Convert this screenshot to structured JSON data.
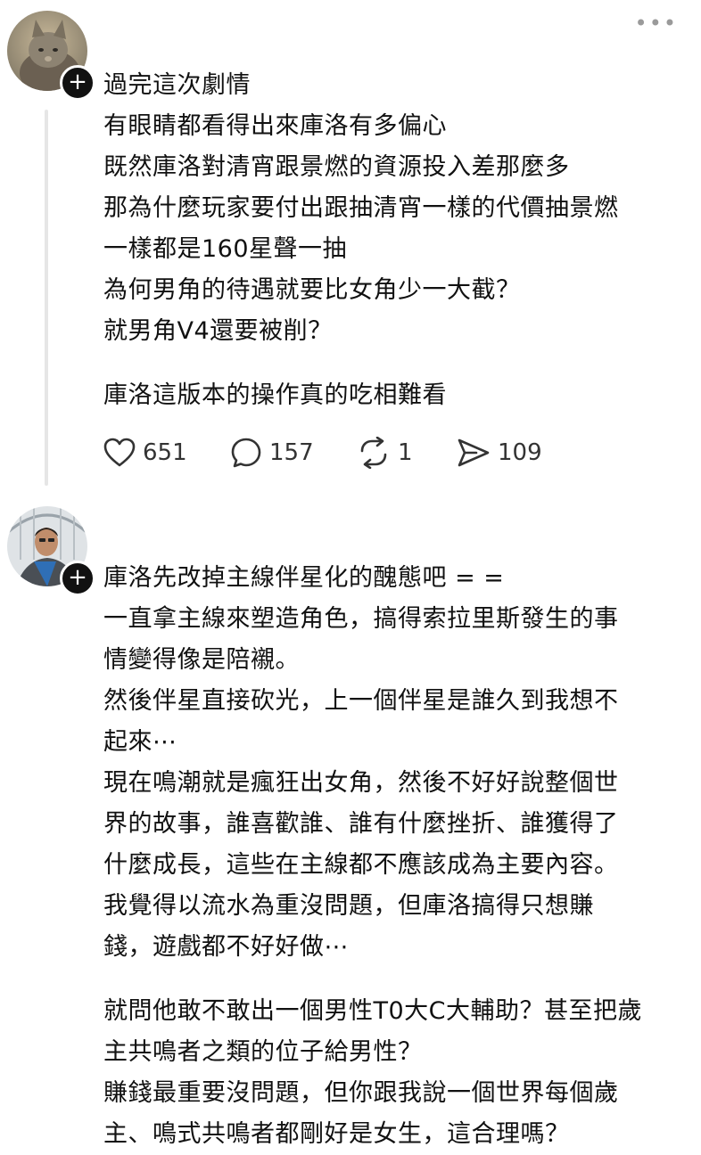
{
  "posts": [
    {
      "avatar_icon": "cat-avatar",
      "follow_icon": "plus-icon",
      "follow_label": "+",
      "more_label": "•••",
      "lines": [
        "過完這次劇情",
        "有眼睛都看得出來庫洛有多偏心",
        "既然庫洛對清宵跟景燃的資源投入差那麼多",
        "那為什麼玩家要付出跟抽清宵一樣的代價抽景燃",
        "一樣都是160星聲一抽",
        "為何男角的待遇就要比女角少一大截？",
        "就男角V4還要被削？",
        "",
        "庫洛這版本的操作真的吃相難看"
      ],
      "actions": {
        "likes": "651",
        "comments": "157",
        "reposts": "1",
        "shares": "109"
      }
    },
    {
      "avatar_icon": "person-avatar",
      "follow_icon": "plus-icon",
      "follow_label": "+",
      "lines": [
        "庫洛先改掉主線伴星化的醜態吧 = =",
        "一直拿主線來塑造角色，搞得索拉里斯發生的事",
        "情變得像是陪襯。",
        "然後伴星直接砍光，上一個伴星是誰久到我想不",
        "起來⋯",
        "現在鳴潮就是瘋狂出女角，然後不好好說整個世",
        "界的故事，誰喜歡誰、誰有什麼挫折、誰獲得了",
        "什麼成長，這些在主線都不應該成為主要內容。",
        "我覺得以流水為重沒問題，但庫洛搞得只想賺",
        "錢，遊戲都不好好做⋯",
        "",
        "就問他敢不敢出一個男性T0大C大輔助？甚至把歲",
        "主共鳴者之類的位子給男性？",
        "賺錢最重要沒問題，但你跟我說一個世界每個歲",
        "主、鳴式共鳴者都剛好是女生，這合理嗎？"
      ]
    }
  ],
  "colors": {
    "text": "#111111",
    "follow_button": "#111111",
    "thread_line": "#e6e6e6",
    "icon": "#333333"
  }
}
